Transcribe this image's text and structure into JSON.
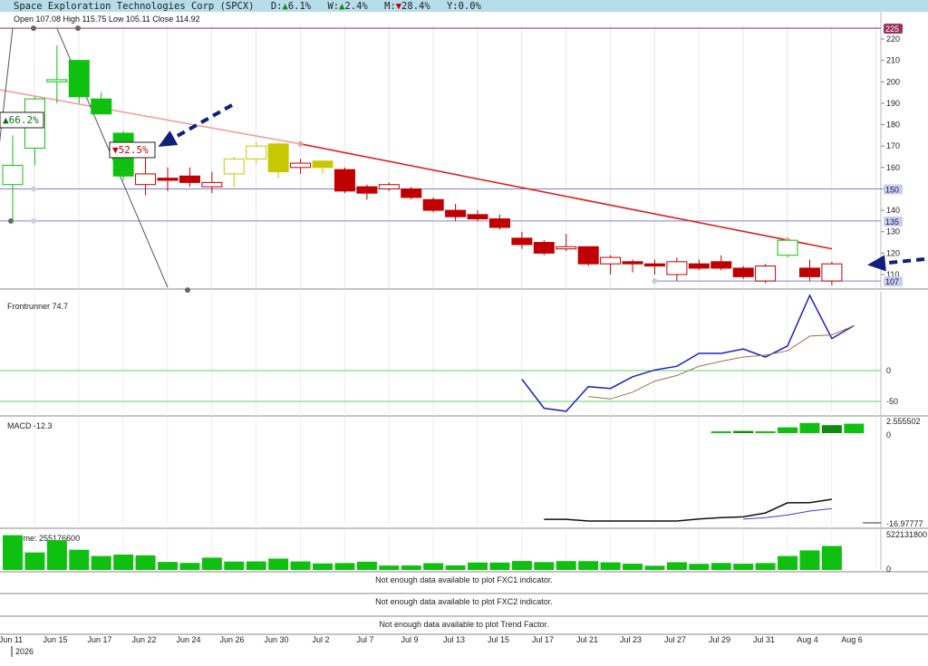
{
  "header": {
    "title": "Space Exploration Technologies Corp (SPCX)",
    "day_label": "D:",
    "day_arrow": "▲",
    "day_value": "6.1%",
    "week_label": "W:",
    "week_arrow": "▲",
    "week_value": "2.4%",
    "month_label": "M:",
    "month_arrow": "▼",
    "month_value": "28.4%",
    "year_label": "Y:",
    "year_value": "0.0%",
    "ohlc": "Open 107.08  High 115.75  Low 105.11  Close 114.92",
    "bg_color": "#b6dde9"
  },
  "colors": {
    "up": "#10c010",
    "down": "#c00000",
    "neutral": "#c8c800",
    "trendline": "#e02020",
    "arrow": "#10207a",
    "macd_hist": "#10c010",
    "macd_hist_dark": "#108a10"
  },
  "chart_data": [
    {
      "type": "candlestick",
      "title": "",
      "ylim": [
        104,
        226
      ],
      "y_ticks": [
        110,
        120,
        130,
        140,
        150,
        160,
        170,
        180,
        190,
        200,
        210,
        220
      ],
      "x_labels": [
        "Jun 11",
        "Jun 15",
        "Jun 17",
        "Jun 22",
        "Jun 24",
        "Jun 26",
        "Jun 30",
        "Jul 2",
        "Jul 7",
        "Jul 9",
        "Jul 13",
        "Jul 15",
        "Jul 17",
        "Jul 21",
        "Jul 23",
        "Jul 27",
        "Jul 29",
        "Jul 31",
        "Aug 4",
        "Aug 6"
      ],
      "year_label": "2026",
      "candles": [
        {
          "o": 152,
          "h": 175,
          "l": 134,
          "c": 161,
          "fill": "hollow",
          "color": "up"
        },
        {
          "o": 169,
          "h": 193,
          "l": 161,
          "c": 192,
          "fill": "hollow",
          "color": "up"
        },
        {
          "o": 200,
          "h": 217,
          "l": 190,
          "c": 201,
          "fill": "hollow",
          "color": "up"
        },
        {
          "o": 193,
          "h": 210,
          "l": 190,
          "c": 210,
          "fill": "solid",
          "color": "up"
        },
        {
          "o": 192,
          "h": 195,
          "l": 185,
          "c": 185,
          "fill": "solid",
          "color": "up"
        },
        {
          "o": 156,
          "h": 177,
          "l": 154,
          "c": 176,
          "fill": "solid",
          "color": "up"
        },
        {
          "o": 157,
          "h": 165,
          "l": 147,
          "c": 152,
          "fill": "hollow",
          "color": "down"
        },
        {
          "o": 154,
          "h": 160,
          "l": 149,
          "c": 155,
          "fill": "solid",
          "color": "down"
        },
        {
          "o": 156,
          "h": 160,
          "l": 151,
          "c": 153,
          "fill": "solid",
          "color": "down"
        },
        {
          "o": 153,
          "h": 158,
          "l": 148,
          "c": 151,
          "fill": "hollow",
          "color": "down"
        },
        {
          "o": 157,
          "h": 165,
          "l": 151,
          "c": 164,
          "fill": "hollow",
          "color": "neutral"
        },
        {
          "o": 164,
          "h": 172,
          "l": 162,
          "c": 170,
          "fill": "hollow",
          "color": "neutral"
        },
        {
          "o": 171,
          "h": 172,
          "l": 155,
          "c": 158,
          "fill": "solid",
          "color": "neutral"
        },
        {
          "o": 162,
          "h": 164,
          "l": 157,
          "c": 160,
          "fill": "hollow",
          "color": "down"
        },
        {
          "o": 160,
          "h": 163,
          "l": 157,
          "c": 163,
          "fill": "solid",
          "color": "neutral"
        },
        {
          "o": 159,
          "h": 160,
          "l": 148,
          "c": 149,
          "fill": "solid",
          "color": "down"
        },
        {
          "o": 151,
          "h": 152,
          "l": 145,
          "c": 148,
          "fill": "solid",
          "color": "down"
        },
        {
          "o": 152,
          "h": 153,
          "l": 149,
          "c": 150,
          "fill": "hollow",
          "color": "down"
        },
        {
          "o": 150,
          "h": 151,
          "l": 145,
          "c": 146,
          "fill": "solid",
          "color": "down"
        },
        {
          "o": 145,
          "h": 146,
          "l": 139,
          "c": 140,
          "fill": "solid",
          "color": "down"
        },
        {
          "o": 140,
          "h": 143,
          "l": 135,
          "c": 137,
          "fill": "solid",
          "color": "down"
        },
        {
          "o": 138,
          "h": 140,
          "l": 135,
          "c": 136,
          "fill": "solid",
          "color": "down"
        },
        {
          "o": 136,
          "h": 138,
          "l": 131,
          "c": 132,
          "fill": "solid",
          "color": "down"
        },
        {
          "o": 127,
          "h": 130,
          "l": 122,
          "c": 124,
          "fill": "solid",
          "color": "down"
        },
        {
          "o": 125,
          "h": 126,
          "l": 119,
          "c": 120,
          "fill": "solid",
          "color": "down"
        },
        {
          "o": 123,
          "h": 129,
          "l": 121,
          "c": 122,
          "fill": "hollow",
          "color": "down"
        },
        {
          "o": 123,
          "h": 123,
          "l": 114,
          "c": 115,
          "fill": "solid",
          "color": "down"
        },
        {
          "o": 118,
          "h": 119,
          "l": 110,
          "c": 115,
          "fill": "hollow",
          "color": "down"
        },
        {
          "o": 116,
          "h": 117,
          "l": 111,
          "c": 115,
          "fill": "solid",
          "color": "down"
        },
        {
          "o": 115,
          "h": 117,
          "l": 110,
          "c": 114,
          "fill": "solid",
          "color": "down"
        },
        {
          "o": 116,
          "h": 118,
          "l": 107,
          "c": 110,
          "fill": "hollow",
          "color": "down"
        },
        {
          "o": 115,
          "h": 117,
          "l": 112,
          "c": 113,
          "fill": "solid",
          "color": "down"
        },
        {
          "o": 116,
          "h": 119,
          "l": 112,
          "c": 113,
          "fill": "solid",
          "color": "down"
        },
        {
          "o": 113,
          "h": 114,
          "l": 108,
          "c": 109,
          "fill": "solid",
          "color": "down"
        },
        {
          "o": 114,
          "h": 115,
          "l": 106,
          "c": 107,
          "fill": "hollow",
          "color": "down"
        },
        {
          "o": 119,
          "h": 126,
          "l": 118,
          "c": 126,
          "fill": "hollow",
          "color": "up"
        },
        {
          "o": 113,
          "h": 117,
          "l": 107,
          "c": 109,
          "fill": "solid",
          "color": "down"
        },
        {
          "o": 107,
          "h": 116,
          "l": 105,
          "c": 115,
          "fill": "hollow",
          "color": "down"
        }
      ],
      "horizontal_lines": [
        {
          "y": 225,
          "color": "#9b2f5f",
          "label": "225"
        },
        {
          "y": 150,
          "color": "#8080d0",
          "label": "150"
        },
        {
          "y": 135,
          "color": "#8080d0",
          "label": "135"
        },
        {
          "y": 107,
          "color": "#8080d0",
          "label": "107",
          "from_candle": 29
        }
      ],
      "trendlines": [
        {
          "x1": -1,
          "y1": 197,
          "x2": 13,
          "y2": 171,
          "color": "#f0a0a0"
        },
        {
          "x1": 13,
          "y1": 171,
          "x2": 37,
          "y2": 122,
          "color": "#e02020"
        },
        {
          "x1": -1,
          "y1": 135,
          "x2": 0,
          "y2": 225,
          "color": "#555555"
        },
        {
          "x1": 2,
          "y1": 225,
          "x2": 7,
          "y2": 104,
          "color": "#555555"
        }
      ],
      "pct_boxes": [
        {
          "arrow": "▲",
          "text": "66.2%",
          "color": "#107010"
        },
        {
          "arrow": "▼",
          "text": "52.5%",
          "color": "#c00000"
        }
      ]
    },
    {
      "type": "line",
      "title": "Frontrunner 74.7",
      "ylim": [
        -64,
        102
      ],
      "y_ticks": [
        0,
        -50
      ],
      "series": [
        {
          "color": "#2020c0",
          "values": [
            null,
            null,
            null,
            null,
            null,
            null,
            null,
            null,
            null,
            null,
            null,
            null,
            null,
            null,
            null,
            null,
            null,
            null,
            null,
            null,
            null,
            null,
            null,
            -14,
            -61,
            -66,
            -26,
            -29,
            -10,
            1,
            7,
            28,
            28,
            35,
            22,
            40,
            122,
            52,
            73
          ]
        },
        {
          "color": "#9b7050",
          "values": [
            null,
            null,
            null,
            null,
            null,
            null,
            null,
            null,
            null,
            null,
            null,
            null,
            null,
            null,
            null,
            null,
            null,
            null,
            null,
            null,
            null,
            null,
            null,
            null,
            null,
            null,
            -42,
            -46,
            -35,
            -17,
            -8,
            7,
            15,
            22,
            25,
            32,
            56,
            58,
            73
          ]
        }
      ]
    },
    {
      "type": "line",
      "title": "MACD -12.3",
      "hist_labels": [
        "2.555502",
        "0"
      ],
      "line_labels": [
        "-16.97777"
      ],
      "histogram": [
        null,
        null,
        null,
        null,
        null,
        null,
        null,
        null,
        null,
        null,
        null,
        null,
        null,
        null,
        null,
        null,
        null,
        null,
        null,
        null,
        null,
        null,
        null,
        null,
        null,
        null,
        null,
        null,
        null,
        null,
        null,
        null,
        0.25,
        0.3,
        0.25,
        0.8,
        1.4,
        1.1,
        1.3
      ],
      "hist_dark_index": [
        33,
        37
      ],
      "series": [
        {
          "color": "#101010",
          "values": [
            null,
            null,
            null,
            null,
            null,
            null,
            null,
            null,
            null,
            null,
            null,
            null,
            null,
            null,
            null,
            null,
            null,
            null,
            null,
            null,
            null,
            null,
            null,
            null,
            -12.5,
            -12.5,
            -13.4,
            -13.4,
            -13.4,
            -13.4,
            -13.4,
            -12.3,
            -11.6,
            -11.2,
            -9.1,
            -3.7,
            -3.6,
            -1.8
          ]
        },
        {
          "color": "#4040d0",
          "values": [
            null,
            null,
            null,
            null,
            null,
            null,
            null,
            null,
            null,
            null,
            null,
            null,
            null,
            null,
            null,
            null,
            null,
            null,
            null,
            null,
            null,
            null,
            null,
            null,
            null,
            null,
            null,
            null,
            null,
            null,
            null,
            null,
            null,
            -12.4,
            -11.6,
            -10.2,
            -8.1,
            -6.8
          ]
        }
      ]
    },
    {
      "type": "bar",
      "title": "Volume: 255176600",
      "max_label": "522131800",
      "zero_label": "0",
      "ylim": [
        0,
        522131800
      ],
      "values": [
        488000000,
        246000000,
        418000000,
        284000000,
        196000000,
        216000000,
        205000000,
        113000000,
        99000000,
        173000000,
        118000000,
        120000000,
        160000000,
        120000000,
        92000000,
        97000000,
        116000000,
        62000000,
        63000000,
        96000000,
        64000000,
        105000000,
        104000000,
        126000000,
        111000000,
        125000000,
        124000000,
        107000000,
        88000000,
        59000000,
        109000000,
        86000000,
        98000000,
        88000000,
        97000000,
        196000000,
        275000000,
        337000000
      ]
    }
  ],
  "messages": [
    "Not enough data available to plot FXC1 indicator.",
    "Not enough data available to plot FXC2 indicator.",
    "Not enough data available to plot Trend Factor."
  ]
}
